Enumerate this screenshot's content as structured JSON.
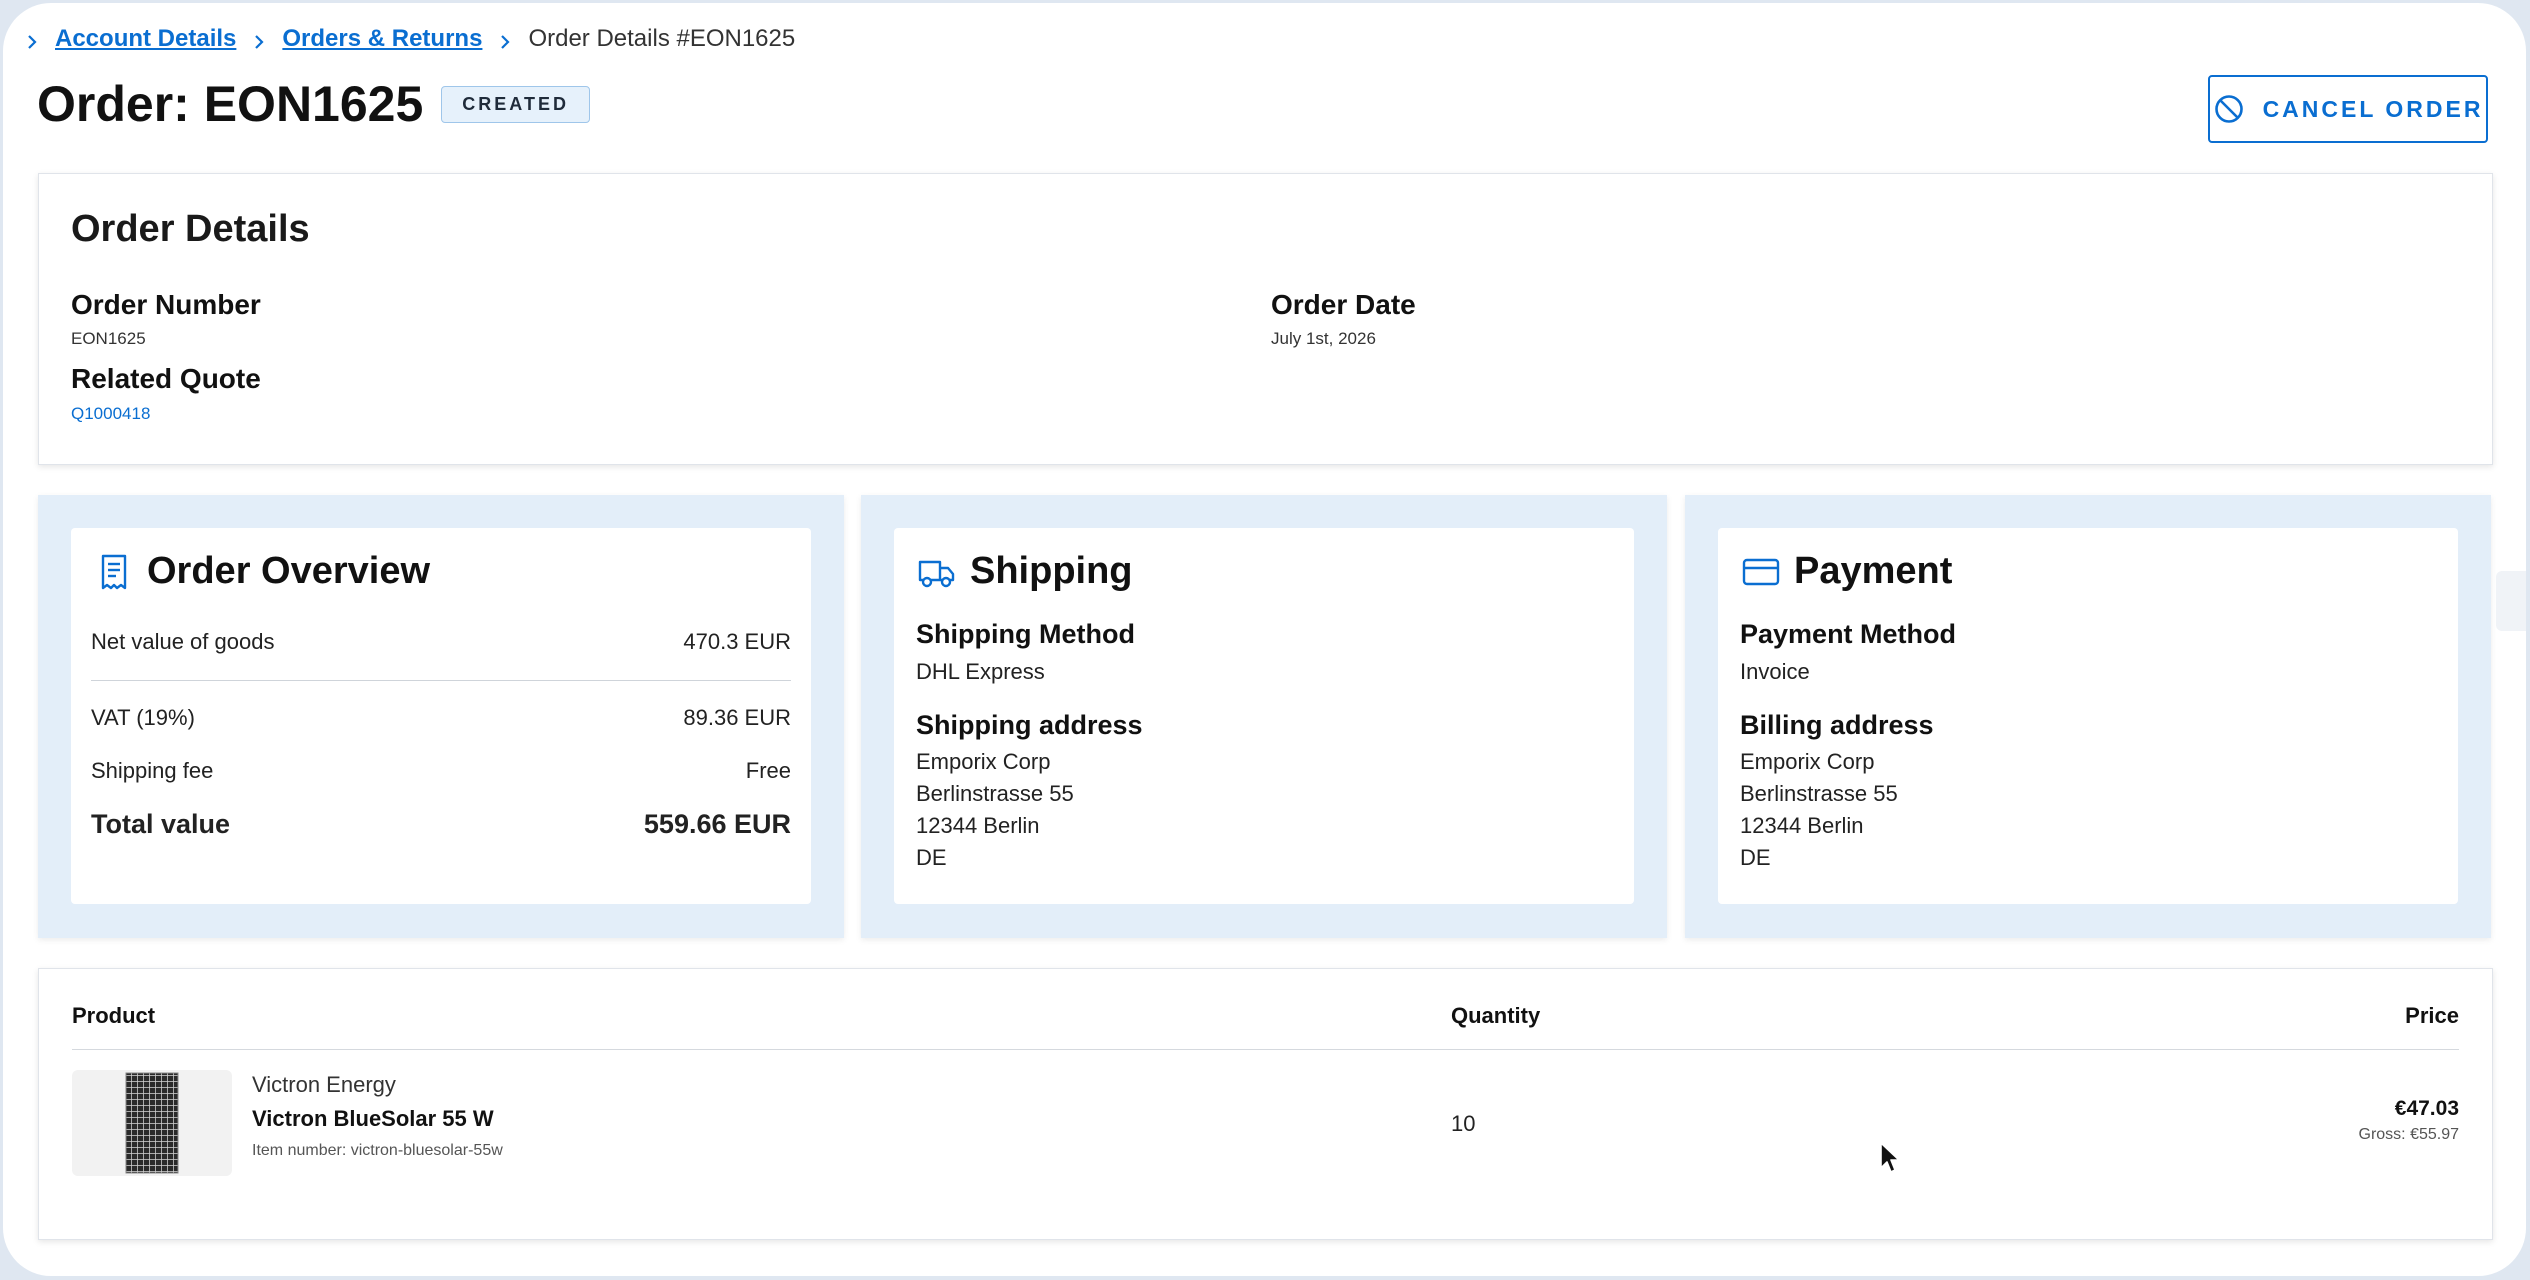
{
  "breadcrumb": {
    "items": [
      "Account Details",
      "Orders & Returns"
    ],
    "current": "Order Details #EON1625"
  },
  "header": {
    "title": "Order: EON1625",
    "status": "CREATED",
    "cancel_label": "CANCEL ORDER"
  },
  "details": {
    "title": "Order Details",
    "order_number_label": "Order Number",
    "order_number": "EON1625",
    "order_date_label": "Order Date",
    "order_date": "July 1st, 2026",
    "related_quote_label": "Related Quote",
    "related_quote": "Q1000418"
  },
  "overview": {
    "title": "Order Overview",
    "net_label": "Net value of goods",
    "net_value": "470.3 EUR",
    "vat_label": "VAT (19%)",
    "vat_value": "89.36 EUR",
    "shipping_fee_label": "Shipping fee",
    "shipping_fee_value": "Free",
    "total_label": "Total value",
    "total_value": "559.66 EUR"
  },
  "shipping": {
    "title": "Shipping",
    "method_label": "Shipping Method",
    "method": "DHL Express",
    "address_label": "Shipping address",
    "address": [
      "Emporix Corp",
      "Berlinstrasse 55",
      "12344 Berlin",
      "DE"
    ]
  },
  "payment": {
    "title": "Payment",
    "method_label": "Payment Method",
    "method": "Invoice",
    "address_label": "Billing address",
    "address": [
      "Emporix Corp",
      "Berlinstrasse 55",
      "12344 Berlin",
      "DE"
    ]
  },
  "products": {
    "columns": [
      "Product",
      "Quantity",
      "Price"
    ],
    "rows": [
      {
        "brand": "Victron Energy",
        "name": "Victron BlueSolar 55 W",
        "item_number": "Item number: victron-bluesolar-55w",
        "quantity": "10",
        "price": "€47.03",
        "gross": "Gross: €55.97"
      }
    ]
  },
  "colors": {
    "accent": "#0a6ed1",
    "panel_bg": "#e3eef9",
    "badge_bg": "#e6f1fb"
  },
  "icons": {
    "overview": "receipt-icon",
    "shipping": "truck-icon",
    "payment": "credit-card-icon",
    "cancel": "ban-icon"
  }
}
